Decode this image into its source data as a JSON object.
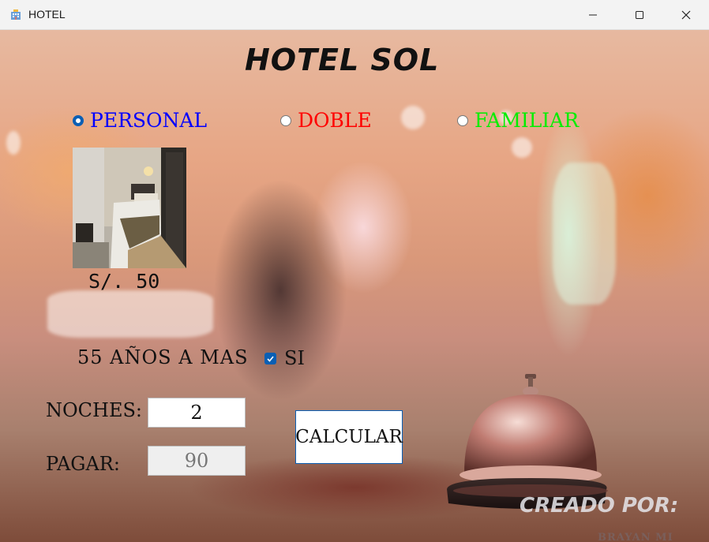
{
  "window": {
    "title": "HOTEL",
    "icon": "hotel-building-icon"
  },
  "app": {
    "heading": "HOTEL SOL"
  },
  "room_types": [
    {
      "label": "PERSONAL",
      "color": "#0000ff",
      "checked": true
    },
    {
      "label": "DOBLE",
      "color": "#ff0000",
      "checked": false
    },
    {
      "label": "FAMILIAR",
      "color": "#00ff00",
      "checked": false
    }
  ],
  "room_image": "hotel-room-photo",
  "price": "S/. 50",
  "senior": {
    "label": "55 AÑOS A MAS",
    "checkbox_label": "SI",
    "checked": true
  },
  "form": {
    "nights_label": "NOCHES:",
    "nights_value": "2",
    "pay_label": "PAGAR:",
    "pay_value": "90",
    "calculate_label": "CALCULAR"
  },
  "credits": {
    "label": "CREADO POR:",
    "name": "BRAYAN MI"
  },
  "colors": {
    "accent": "#0a5fb4"
  }
}
